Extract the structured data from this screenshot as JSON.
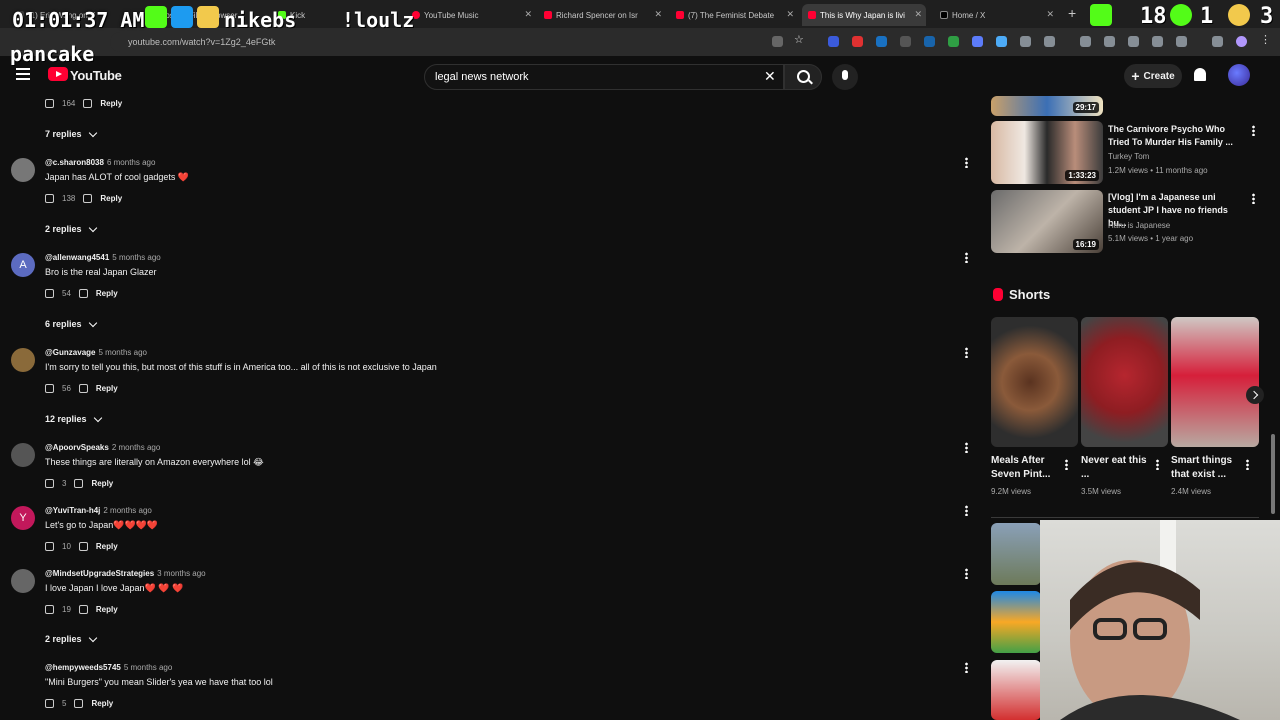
{
  "browser": {
    "tabs": [
      {
        "label": "(1) Eric Wang on X"
      },
      {
        "label": "Epstein Files Browser"
      },
      {
        "label": "Kick"
      },
      {
        "label": "YouTube Music"
      },
      {
        "label": "Richard Spencer on Isr"
      },
      {
        "label": "(7) The Feminist Debate"
      },
      {
        "label": "This is Why Japan is livi"
      },
      {
        "label": "Home / X"
      }
    ],
    "url": "youtube.com/watch?v=1Zg2_4eFGtk"
  },
  "overlay": {
    "clock": "01:01:37 AM",
    "streamer": "nikebs",
    "tag": "!loulz",
    "handle": "pancake",
    "count1": "18",
    "count2": "1",
    "count3": "3"
  },
  "header": {
    "logo_text": "YouTube",
    "search_value": "legal news network",
    "create_label": "Create"
  },
  "comments": [
    {
      "replies_label": "7 replies"
    },
    {
      "author": "@c.sharon8038",
      "ago": "6 months ago",
      "text": "Japan has ALOT of cool gadgets ❤️",
      "likes": "138",
      "reply": "Reply",
      "replies_label": "2 replies",
      "avatar": "",
      "color": "#777"
    },
    {
      "author": "@allenwang4541",
      "ago": "5 months ago",
      "text": "Bro is the real Japan Glazer",
      "likes": "54",
      "reply": "Reply",
      "replies_label": "6 replies",
      "avatar": "A",
      "color": "#5c6bc0"
    },
    {
      "author": "@Gunzavage",
      "ago": "5 months ago",
      "text": "I'm sorry to tell you this, but most of this stuff is in America too... all of this is not exclusive to Japan",
      "likes": "56",
      "reply": "Reply",
      "replies_label": "12 replies",
      "avatar": "",
      "color": "#8a6a3a"
    },
    {
      "author": "@ApoorvSpeaks",
      "ago": "2 months ago",
      "text": "These things are literally on Amazon everywhere lol 😂",
      "likes": "3",
      "reply": "Reply",
      "avatar": "",
      "color": "#555"
    },
    {
      "author": "@YuviTran-h4j",
      "ago": "2 months ago",
      "text": "Let's go to Japan❤️❤️❤️❤️",
      "likes": "10",
      "reply": "Reply",
      "avatar": "Y",
      "color": "#c2185b"
    },
    {
      "author": "@MindsetUpgradeStrategies",
      "ago": "3 months ago",
      "text": "I love Japan I love Japan❤️ ❤️ ❤️",
      "likes": "19",
      "reply": "Reply",
      "replies_label": "2 replies",
      "avatar": "",
      "color": "#666"
    },
    {
      "author": "@hempyweeds5745",
      "ago": "5 months ago",
      "text": "\"Mini Burgers\" you mean Slider's yea we have that too lol",
      "likes": "5",
      "reply": "Reply",
      "avatar": "",
      "color": "#0f0f0f"
    }
  ],
  "first_row": {
    "likes": "164",
    "reply": "Reply"
  },
  "related": [
    {
      "title": "The Carnivore Psycho Who Tried To Murder His Family ...",
      "channel": "Turkey Tom",
      "meta": "1.2M views • 11 months ago",
      "duration": "1:33:23"
    },
    {
      "title": "[Vlog] I'm a Japanese uni student JP I have no friends bu...",
      "channel": "Haru is Japanese",
      "meta": "5.1M views • 1 year ago",
      "duration": "16:19"
    }
  ],
  "top_thumb_duration": "29:17",
  "shorts": {
    "heading": "Shorts",
    "items": [
      {
        "title": "Meals After Seven Pint...",
        "views": "9.2M views"
      },
      {
        "title": "Never eat this ...",
        "views": "3.5M views"
      },
      {
        "title": "Smart things that exist ...",
        "views": "2.4M views"
      }
    ]
  }
}
